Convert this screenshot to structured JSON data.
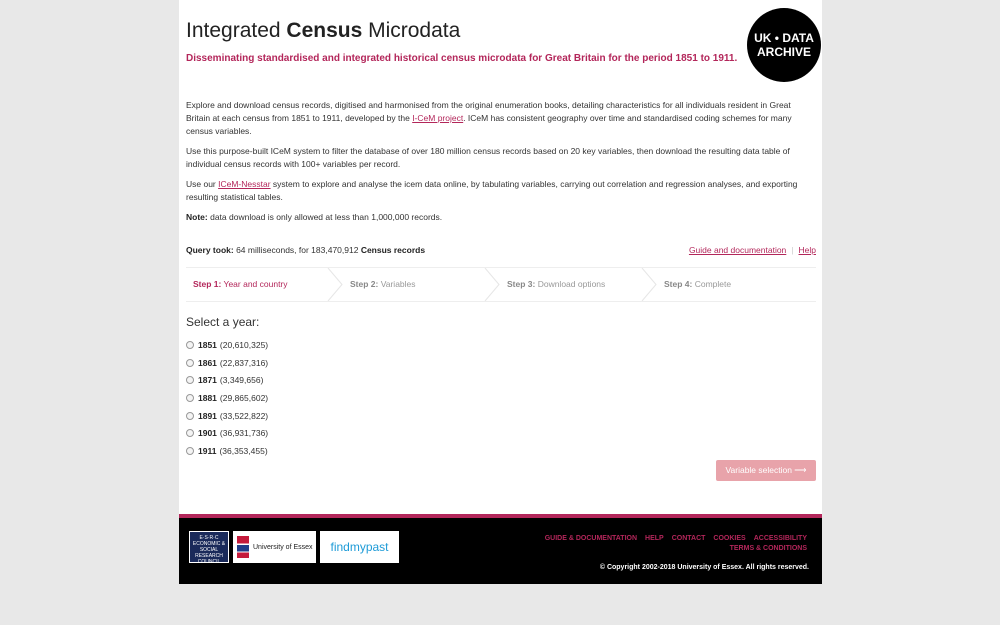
{
  "header": {
    "title_pre": "Integrated ",
    "title_bold": "Census",
    "title_post": " Microdata",
    "subtitle": "Disseminating standardised and integrated historical census microdata for Great Britain for the period 1851 to 1911.",
    "logo_line1": "UK • DATA",
    "logo_line2": "ARCHIVE"
  },
  "intro": {
    "p1_a": "Explore and download census records, digitised and harmonised from the original enumeration books, detailing characteristics for all individuals resident in Great Britain at each census from 1851 to 1911, developed by the ",
    "p1_link": "I-CeM project",
    "p1_b": ". ICeM has consistent geography over time and standardised coding schemes for many census variables.",
    "p2": "Use this purpose-built ICeM system to filter the database of over 180 million census records based on 20 key variables, then download the resulting data table of individual census records with 100+ variables per record.",
    "p3_a": "Use our ",
    "p3_link": "ICeM-Nesstar",
    "p3_b": " system to explore and analyse the icem data online, by tabulating variables, carrying out correlation and regression analyses, and exporting resulting statistical tables.",
    "note_label": "Note:",
    "note_text": " data download is only allowed at less than 1,000,000 records."
  },
  "query": {
    "label": "Query took:",
    "text": " 64 milliseconds, for 183,470,912 ",
    "records": "Census records",
    "guide_link": "Guide and documentation",
    "help_link": "Help"
  },
  "steps": [
    {
      "num": "Step 1:",
      "label": " Year and country"
    },
    {
      "num": "Step 2:",
      "label": " Variables"
    },
    {
      "num": "Step 3:",
      "label": " Download options"
    },
    {
      "num": "Step 4:",
      "label": " Complete"
    }
  ],
  "year_heading": "Select a year:",
  "years": [
    {
      "year": "1851",
      "count": "(20,610,325)"
    },
    {
      "year": "1861",
      "count": "(22,837,316)"
    },
    {
      "year": "1871",
      "count": "(3,349,656)"
    },
    {
      "year": "1881",
      "count": "(29,865,602)"
    },
    {
      "year": "1891",
      "count": "(33,522,822)"
    },
    {
      "year": "1901",
      "count": "(36,931,736)"
    },
    {
      "year": "1911",
      "count": "(36,353,455)"
    }
  ],
  "next_button": "Variable selection ⟶",
  "footer": {
    "esrc": "E·S·R·C ECONOMIC & SOCIAL RESEARCH COUNCIL",
    "essex": "University of Essex",
    "fmp": "findmypast",
    "links": [
      "GUIDE & DOCUMENTATION",
      "HELP",
      "CONTACT",
      "COOKIES",
      "ACCESSIBILITY"
    ],
    "terms": "TERMS & CONDITIONS",
    "copyright": "© Copyright 2002-2018 University of Essex. All rights reserved."
  },
  "colors": {
    "accent": "#b3265a",
    "button": "#e8a3aa"
  }
}
